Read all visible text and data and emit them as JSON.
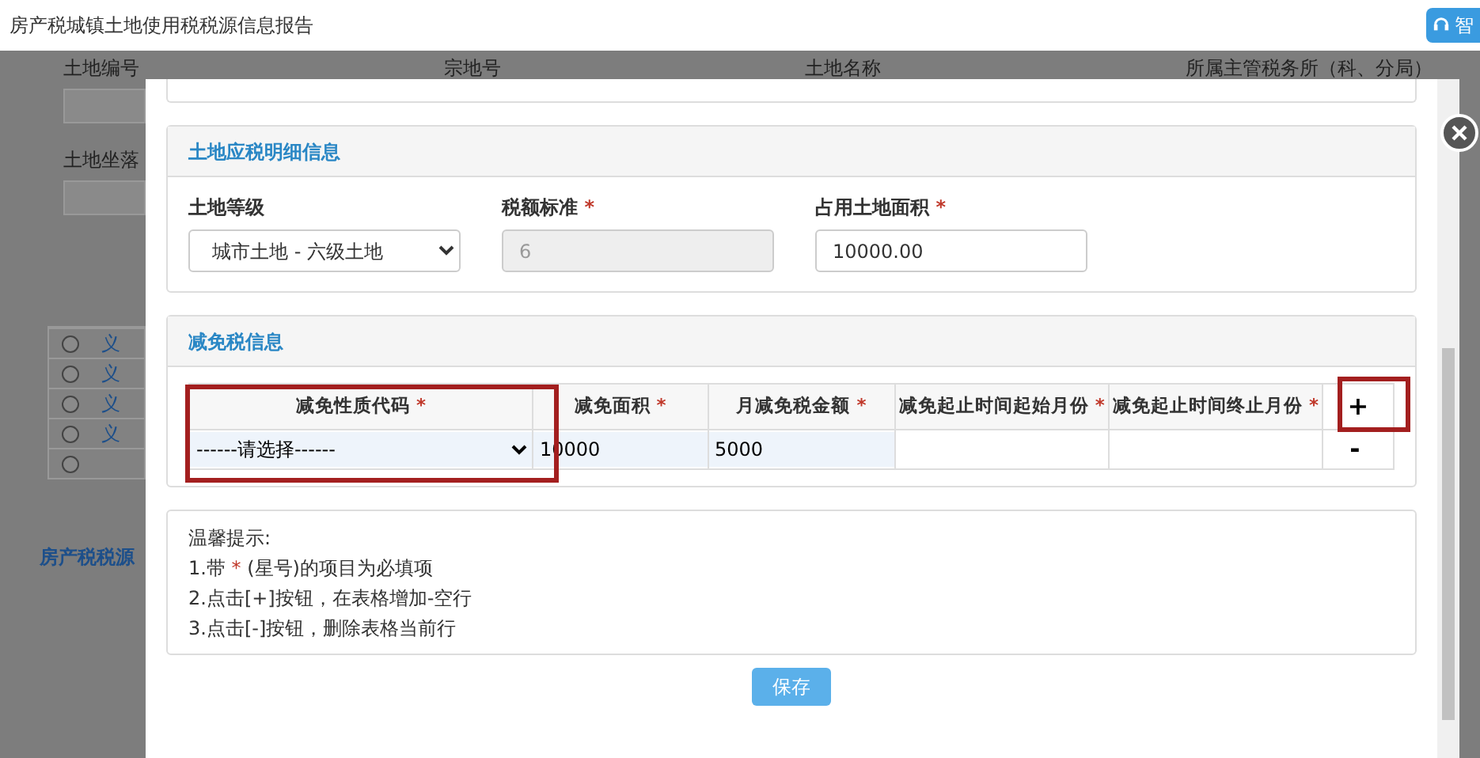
{
  "window": {
    "title": "房产税城镇土地使用税税源信息报告",
    "assistant_button": "智"
  },
  "background": {
    "columns": [
      "土地编号",
      "宗地号",
      "土地名称",
      "所属主管税务所（科、分局）"
    ],
    "location_label": "土地坐落",
    "rows": [
      {
        "link": "义",
        "selected": false
      },
      {
        "link": "义",
        "selected": false
      },
      {
        "link": "义",
        "selected": false
      },
      {
        "link": "义",
        "selected": false
      },
      {
        "link": "",
        "selected": false
      }
    ],
    "section_title": "房产税税源"
  },
  "detail_panel": {
    "title": "土地应税明细信息",
    "fields": [
      {
        "kind": "select",
        "label": "土地等级",
        "required": false,
        "value": "城市土地 - 六级土地",
        "disabled": false
      },
      {
        "kind": "input",
        "label": "税额标准",
        "required": true,
        "value": "6",
        "disabled": true
      },
      {
        "kind": "input",
        "label": "占用土地面积",
        "required": true,
        "value": "10000.00",
        "disabled": false
      }
    ]
  },
  "relief_panel": {
    "title": "减免税信息",
    "columns": [
      {
        "label": "减免性质代码",
        "required": true,
        "highlighted": true
      },
      {
        "label": "减免面积",
        "required": true,
        "highlighted": false
      },
      {
        "label": "月减免税金额",
        "required": true,
        "highlighted": false
      },
      {
        "label": "减免起止时间起始月份",
        "required": true,
        "highlighted": false
      },
      {
        "label": "减免起止时间终止月份",
        "required": true,
        "highlighted": false
      }
    ],
    "add_button": {
      "label": "+",
      "highlighted": true
    },
    "rows": [
      {
        "cells": [
          {
            "kind": "select",
            "value": "------请选择------"
          },
          {
            "kind": "input",
            "value": "10000"
          },
          {
            "kind": "input",
            "value": "5000"
          },
          {
            "kind": "input"
          },
          {
            "kind": "input"
          }
        ],
        "remove_button": "-"
      }
    ]
  },
  "tips": {
    "title": "温馨提示:",
    "lines": [
      {
        "before": "1.带",
        "mark": "*",
        "after": "(星号)的项目为必填项"
      },
      {
        "before": "2.点击[+]按钮，在表格增加-空行"
      },
      {
        "before": "3.点击[-]按钮，删除表格当前行"
      }
    ]
  },
  "save_button": "保存"
}
